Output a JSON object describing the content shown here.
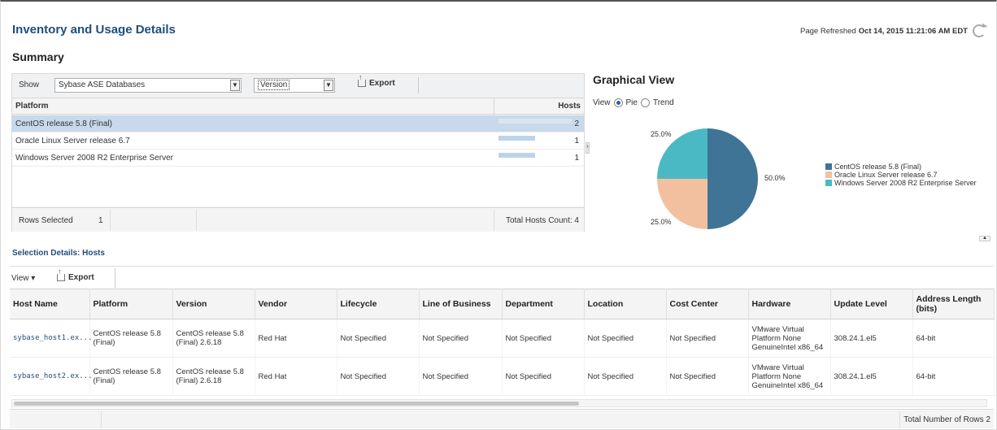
{
  "header": {
    "title": "Inventory and Usage Details",
    "refresh_label": "Page Refreshed",
    "refresh_time": "Oct 14, 2015 11:21:06 AM EDT"
  },
  "summary": {
    "title": "Summary",
    "show_label": "Show",
    "show_value": "Sybase ASE Databases",
    "version_value": "Version",
    "export_label": "Export",
    "columns": {
      "platform": "Platform",
      "hosts": "Hosts"
    },
    "rows": [
      {
        "platform": "CentOS release 5.8 (Final)",
        "hosts": "2",
        "share": 1.0,
        "selected": true
      },
      {
        "platform": "Oracle Linux Server release 6.7",
        "hosts": "1",
        "share": 0.5,
        "selected": false
      },
      {
        "platform": "Windows Server 2008 R2 Enterprise Server",
        "hosts": "1",
        "share": 0.5,
        "selected": false
      }
    ],
    "rows_selected_label": "Rows Selected",
    "rows_selected_value": "1",
    "total_hosts": "Total Hosts Count: 4"
  },
  "graphical": {
    "title": "Graphical View",
    "view_label": "View",
    "pie_label": "Pie",
    "trend_label": "Trend",
    "selected_option": "Pie"
  },
  "chart_data": {
    "type": "pie",
    "labels": [
      "CentOS release 5.8 (Final)",
      "Oracle Linux Server release 6.7",
      "Windows Server 2008 R2 Enterprise Server"
    ],
    "values": [
      50.0,
      25.0,
      25.0
    ],
    "value_labels": [
      "50.0%",
      "25.0%",
      "25.0%"
    ],
    "colors": [
      "#3f7497",
      "#f2c09f",
      "#4ab9c4"
    ],
    "legend": "right"
  },
  "details": {
    "title": "Selection Details: Hosts",
    "view_label": "View ▾",
    "export_label": "Export",
    "columns": [
      "Host Name",
      "Platform",
      "Version",
      "Vendor",
      "Lifecycle",
      "Line of Business",
      "Department",
      "Location",
      "Cost Center",
      "Hardware",
      "Update Level",
      "Address Length (bits)"
    ],
    "rows": [
      [
        "sybase_host1.ex...",
        "CentOS release 5.8 (Final)",
        "CentOS release 5.8 (Final) 2.6.18",
        "Red Hat",
        "Not Specified",
        "Not Specified",
        "Not Specified",
        "Not Specified",
        "Not Specified",
        "VMware Virtual Platform None GenuineIntel x86_64",
        "308.24.1.el5",
        "64-bit"
      ],
      [
        "sybase_host2.ex...",
        "CentOS release 5.8 (Final)",
        "CentOS release 5.8 (Final) 2.6.18",
        "Red Hat",
        "Not Specified",
        "Not Specified",
        "Not Specified",
        "Not Specified",
        "Not Specified",
        "VMware Virtual Platform None GenuineIntel x86_64",
        "308.24.1.el5",
        "64-bit"
      ]
    ],
    "total_rows": "Total Number of Rows 2"
  }
}
